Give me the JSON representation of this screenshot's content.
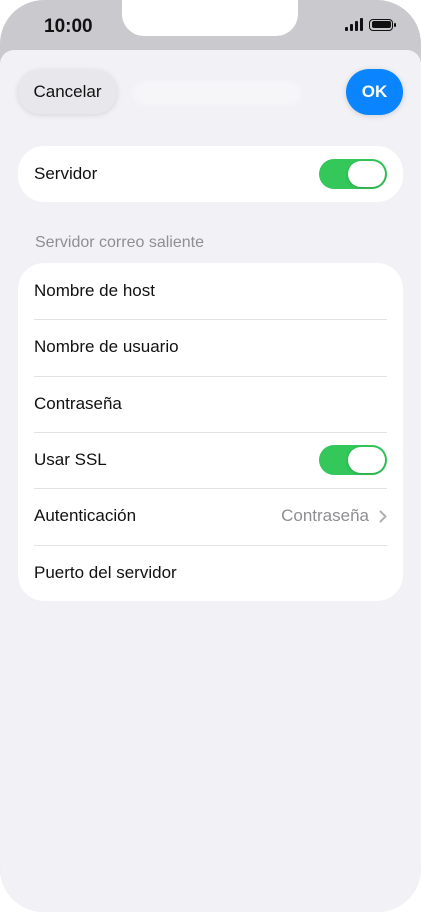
{
  "status_bar": {
    "time": "10:00",
    "signal_icon": "signal-icon",
    "battery_icon": "battery-icon"
  },
  "nav": {
    "cancel_label": "Cancelar",
    "ok_label": "OK"
  },
  "server_section": {
    "label": "Servidor",
    "toggle_on": true
  },
  "outgoing_section": {
    "header": "Servidor correo saliente",
    "rows": [
      {
        "label": "Nombre de host"
      },
      {
        "label": "Nombre de usuario"
      },
      {
        "label": "Contraseña"
      },
      {
        "label": "Usar SSL",
        "toggle_on": true
      },
      {
        "label": "Autenticación",
        "value": "Contraseña"
      },
      {
        "label": "Puerto del servidor"
      }
    ]
  },
  "colors": {
    "accent": "#0a84ff",
    "toggle_on": "#34c759",
    "secondary_text": "#8e8e93",
    "background": "#f1f1f6"
  }
}
